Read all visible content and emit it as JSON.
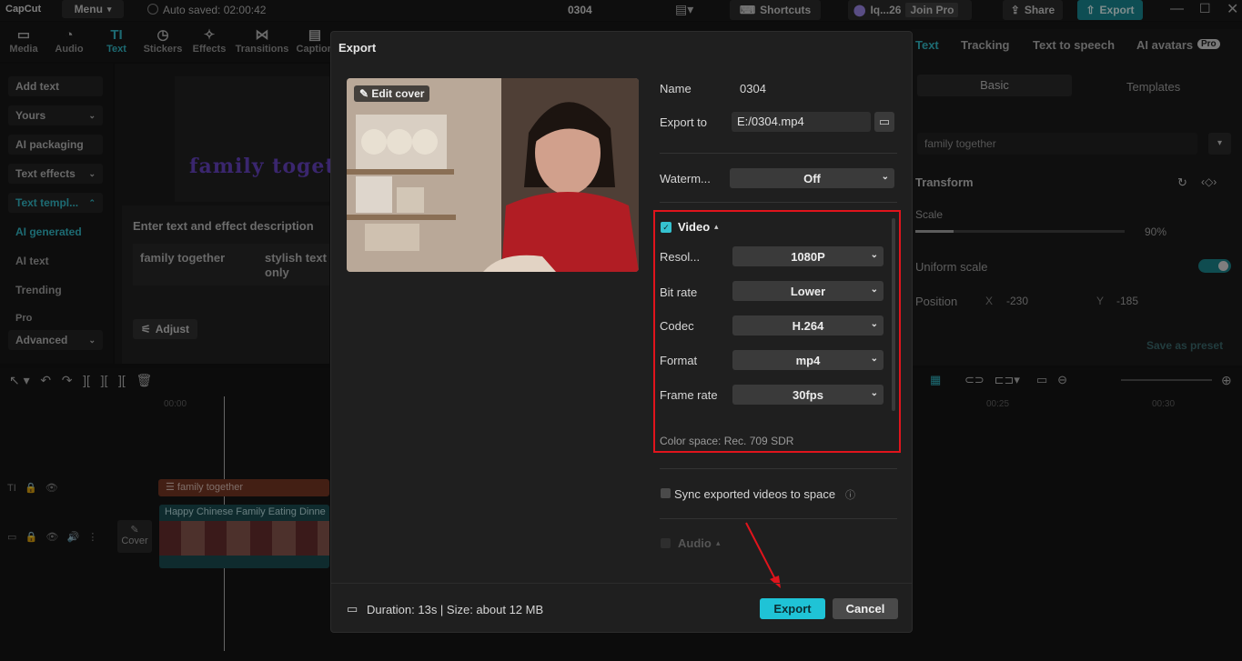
{
  "app": {
    "logo": "CapCut",
    "menu": "Menu",
    "autosave": "Auto saved: 02:00:42",
    "project": "0304",
    "shortcuts": "Shortcuts",
    "user": "Iq...26",
    "join_pro": "Join Pro",
    "share": "Share",
    "export": "Export"
  },
  "tools": [
    {
      "label": "Media",
      "icon": "▭"
    },
    {
      "label": "Audio",
      "icon": "◔"
    },
    {
      "label": "Text",
      "icon": "TI"
    },
    {
      "label": "Stickers",
      "icon": "◷"
    },
    {
      "label": "Effects",
      "icon": "✧"
    },
    {
      "label": "Transitions",
      "icon": "⋈"
    },
    {
      "label": "Caption",
      "icon": "▤"
    }
  ],
  "left_panel": {
    "add_text": "Add text",
    "yours": "Yours",
    "ai_packaging": "AI packaging",
    "text_effects": "Text effects",
    "text_templates": "Text templ...",
    "ai_generated": "AI generated",
    "ai_text": "AI text",
    "trending": "Trending",
    "pro": "Pro",
    "advanced": "Advanced"
  },
  "center": {
    "preview_text": "family toget",
    "prompt_label": "Enter text and effect description",
    "chip1": "family together",
    "chip2": "stylish text only",
    "adjust": "Adjust"
  },
  "right_panel": {
    "tabs": [
      "Text",
      "Tracking",
      "Text to speech",
      "AI avatars"
    ],
    "pro_badge": "Pro",
    "subtabs": [
      "Basic",
      "Templates"
    ],
    "paragraph_value": "family together",
    "transform": "Transform",
    "scale": "Scale",
    "scale_value": "90%",
    "uniform_scale": "Uniform scale",
    "position": "Position",
    "pos_x_label": "X",
    "pos_x": "-230",
    "pos_y_label": "Y",
    "pos_y": "-185",
    "save_preset": "Save as preset"
  },
  "timeline": {
    "t0": "00:00",
    "t25": "00:25",
    "t30": "00:30",
    "text_clip": "family together",
    "video_clip": "Happy Chinese Family Eating Dinne",
    "cover": "Cover"
  },
  "dialog": {
    "title": "Export",
    "edit_cover": "Edit cover",
    "name_label": "Name",
    "name_value": "0304",
    "export_to_label": "Export to",
    "export_to_value": "E:/0304.mp4",
    "watermark_label": "Waterm...",
    "watermark_value": "Off",
    "video_label": "Video",
    "rows": [
      {
        "label": "Resol...",
        "value": "1080P"
      },
      {
        "label": "Bit rate",
        "value": "Lower"
      },
      {
        "label": "Codec",
        "value": "H.264"
      },
      {
        "label": "Format",
        "value": "mp4"
      },
      {
        "label": "Frame rate",
        "value": "30fps"
      }
    ],
    "color_space": "Color space: Rec. 709 SDR",
    "sync_label": "Sync exported videos to space",
    "audio_label": "Audio",
    "duration": "Duration: 13s | Size: about 12 MB",
    "export_btn": "Export",
    "cancel_btn": "Cancel"
  },
  "colors": {
    "accent": "#35c2cf",
    "highlight": "#e0141c",
    "export_btn": "#1fc3d6"
  }
}
